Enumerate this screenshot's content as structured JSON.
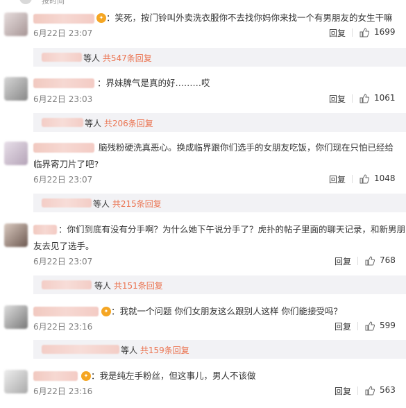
{
  "top_partial_text": "按时间",
  "comments": [
    {
      "text": "：笑死，按门铃叫外卖洗衣服你不去找你妈你来找一个有男朋友的女生干嘛",
      "date": "6月22日 23:07",
      "reply_label": "回复",
      "likes": "1699",
      "sub": {
        "prefix": "等人",
        "link": "共547条回复"
      }
    },
    {
      "text": "：界妹脾气是真的好………哎",
      "date": "6月22日 23:03",
      "reply_label": "回复",
      "likes": "1061",
      "sub": {
        "prefix": "等人",
        "link": "共206条回复"
      }
    },
    {
      "text": "脑残粉硬洗真恶心。换成临界跟你们选手的女朋友吃饭，你们现在只怕已经给",
      "text2": "临界寄刀片了吧?",
      "date": "6月22日 23:07",
      "reply_label": "回复",
      "likes": "1048",
      "sub": {
        "prefix": "等人",
        "link": "共215条回复"
      }
    },
    {
      "text": "：你们到底有没有分手啊？为什么她下午说分手了？虎扑的帖子里面的聊天记录，和新男朋",
      "text2": "友去见了选手。",
      "date": "6月22日 23:07",
      "reply_label": "回复",
      "likes": "768",
      "sub": {
        "prefix": "等人",
        "link": "共151条回复"
      }
    },
    {
      "text": "：我就一个问题 你们女朋友这么跟别人这样 你们能接受吗？",
      "date": "6月22日 23:16",
      "reply_label": "回复",
      "likes": "599",
      "sub": {
        "prefix": "等人",
        "link": "共159条回复"
      }
    },
    {
      "text": "：我是纯左手粉丝，但这事儿，男人不该做",
      "date": "6月22日 23:16",
      "reply_label": "回复",
      "likes": "563"
    }
  ],
  "colors": {
    "link": "#eb7350",
    "meta": "#808080",
    "subbox_bg": "#f2f2f5"
  }
}
